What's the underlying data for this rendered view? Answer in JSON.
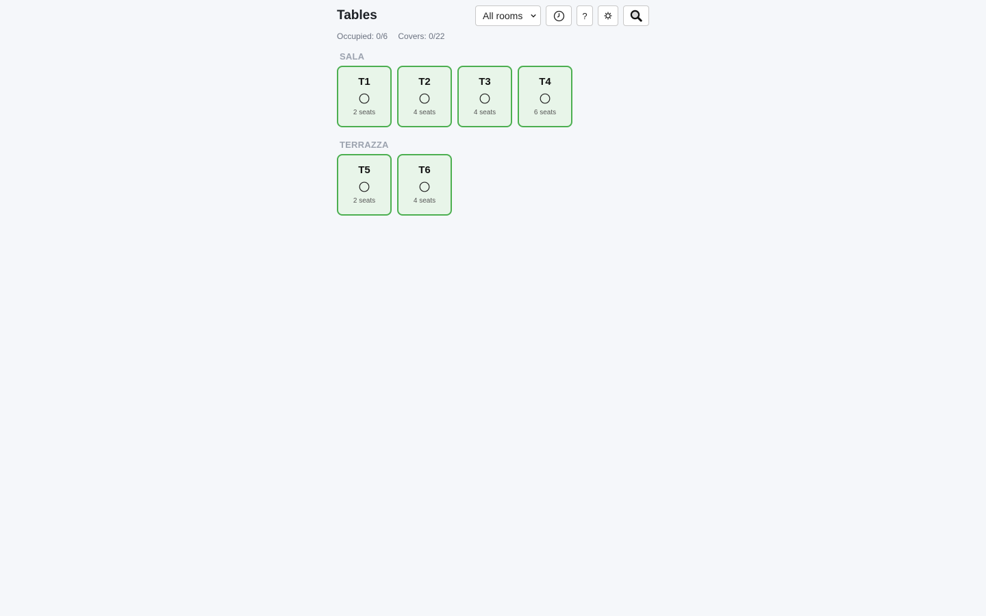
{
  "header": {
    "title": "Tables",
    "room_filter": {
      "selected": "All rooms"
    },
    "help_label": "?"
  },
  "stats": {
    "occupied": "Occupied: 0/6",
    "covers": "Covers: 0/22"
  },
  "rooms": [
    {
      "name": "SALA",
      "tables": [
        {
          "name": "T1",
          "seats": "2 seats"
        },
        {
          "name": "T2",
          "seats": "4 seats"
        },
        {
          "name": "T3",
          "seats": "4 seats"
        },
        {
          "name": "T4",
          "seats": "6 seats"
        }
      ]
    },
    {
      "name": "TERRAZZA",
      "tables": [
        {
          "name": "T5",
          "seats": "2 seats"
        },
        {
          "name": "T6",
          "seats": "4 seats"
        }
      ]
    }
  ],
  "colors": {
    "free_border": "#4caf50",
    "free_fill": "#e8f5e9",
    "background": "#f5f7fa"
  },
  "icons": {
    "history": "clock-icon",
    "settings": "gear-icon",
    "search": "search-icon",
    "table_status": "empty-circle-icon"
  }
}
